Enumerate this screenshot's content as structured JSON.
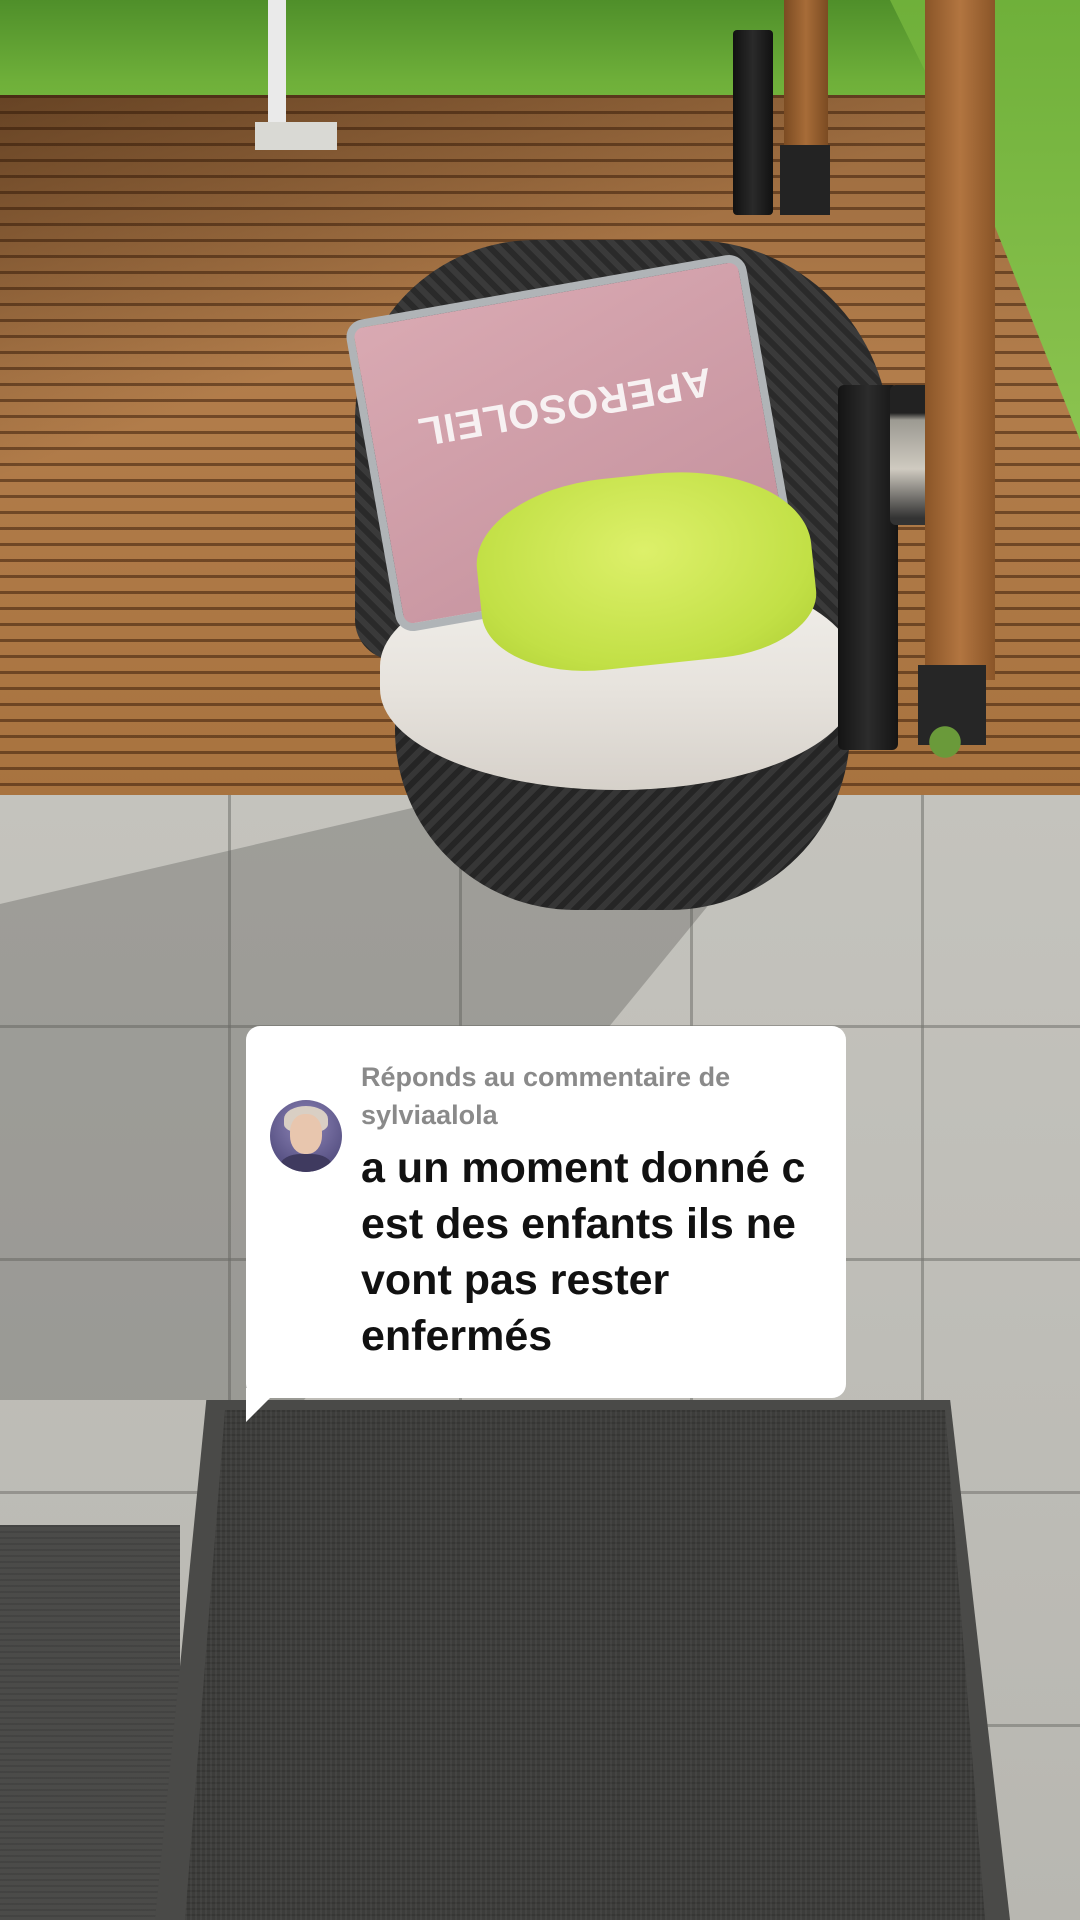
{
  "comment_reply": {
    "label": "Réponds au commentaire de sylviaalola",
    "text": "a un moment donné c est des enfants ils ne vont pas rester enfermés"
  },
  "scene": {
    "pillow_print": "APEROSOLEIL"
  },
  "colors": {
    "card_background": "#ffffff",
    "label_color": "#8a8a8a",
    "text_color": "#111111"
  }
}
